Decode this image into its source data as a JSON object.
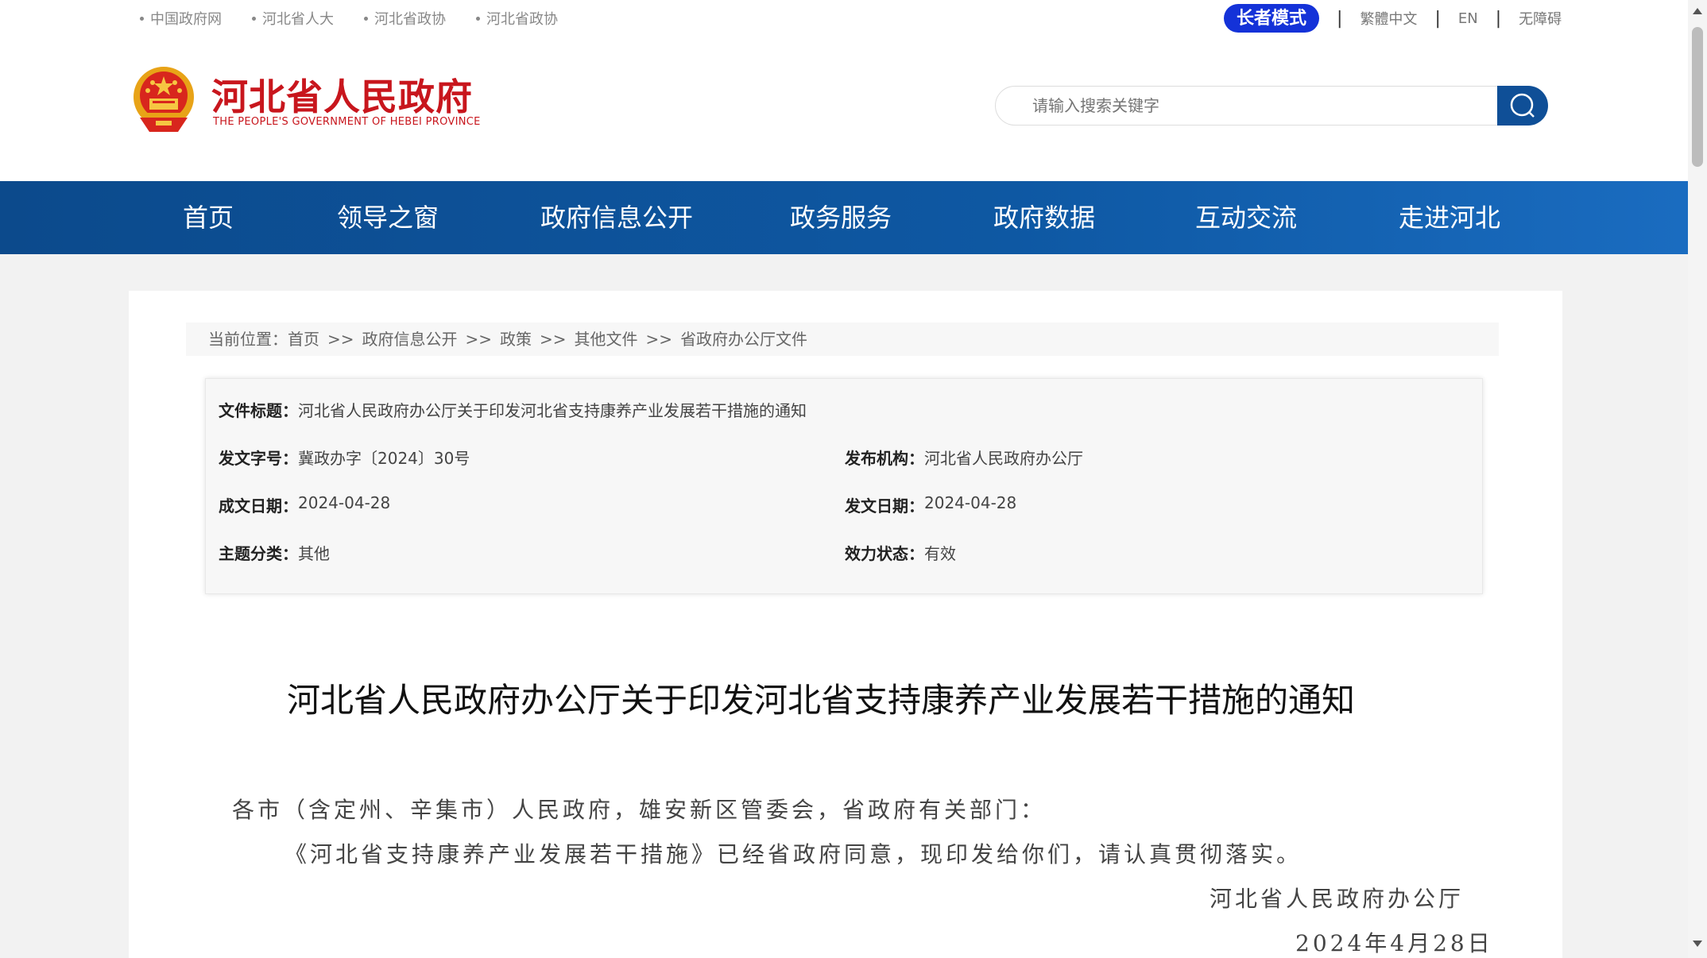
{
  "top_links": [
    "中国政府网",
    "河北省人大",
    "河北省政协",
    "河北省政协"
  ],
  "top_right": {
    "elder_mode": "长者模式",
    "traditional": "繁體中文",
    "english": "EN",
    "accessibility": "无障碍"
  },
  "header": {
    "title": "河北省人民政府",
    "subtitle": "THE PEOPLE'S GOVERNMENT OF HEBEI PROVINCE",
    "search_placeholder": "请输入搜索关键字"
  },
  "nav": [
    "首页",
    "领导之窗",
    "政府信息公开",
    "政务服务",
    "政府数据",
    "互动交流",
    "走进河北"
  ],
  "breadcrumb": {
    "prefix": "当前位置：",
    "items": [
      "首页",
      "政府信息公开",
      "政策",
      "其他文件",
      "省政府办公厅文件"
    ],
    "separator": ">>"
  },
  "info": {
    "title_label": "文件标题：",
    "title_value": "河北省人民政府办公厅关于印发河北省支持康养产业发展若干措施的通知",
    "doc_no_label": "发文字号：",
    "doc_no_value": "冀政办字〔2024〕30号",
    "issuer_label": "发布机构：",
    "issuer_value": "河北省人民政府办公厅",
    "written_date_label": "成文日期：",
    "written_date_value": "2024-04-28",
    "issue_date_label": "发文日期：",
    "issue_date_value": "2024-04-28",
    "topic_label": "主题分类：",
    "topic_value": "其他",
    "status_label": "效力状态：",
    "status_value": "有效"
  },
  "document": {
    "title": "河北省人民政府办公厅关于印发河北省支持康养产业发展若干措施的通知",
    "salutation": "各市（含定州、辛集市）人民政府，雄安新区管委会，省政府有关部门：",
    "paragraph": "《河北省支持康养产业发展若干措施》已经省政府同意，现印发给你们，请认真贯彻落实。",
    "signature": "河北省人民政府办公厅",
    "date": "2024年4月28日"
  },
  "colors": {
    "nav_blue": "#0e58a3",
    "brand_red": "#c8161d",
    "elder_blue": "#1432d8"
  }
}
